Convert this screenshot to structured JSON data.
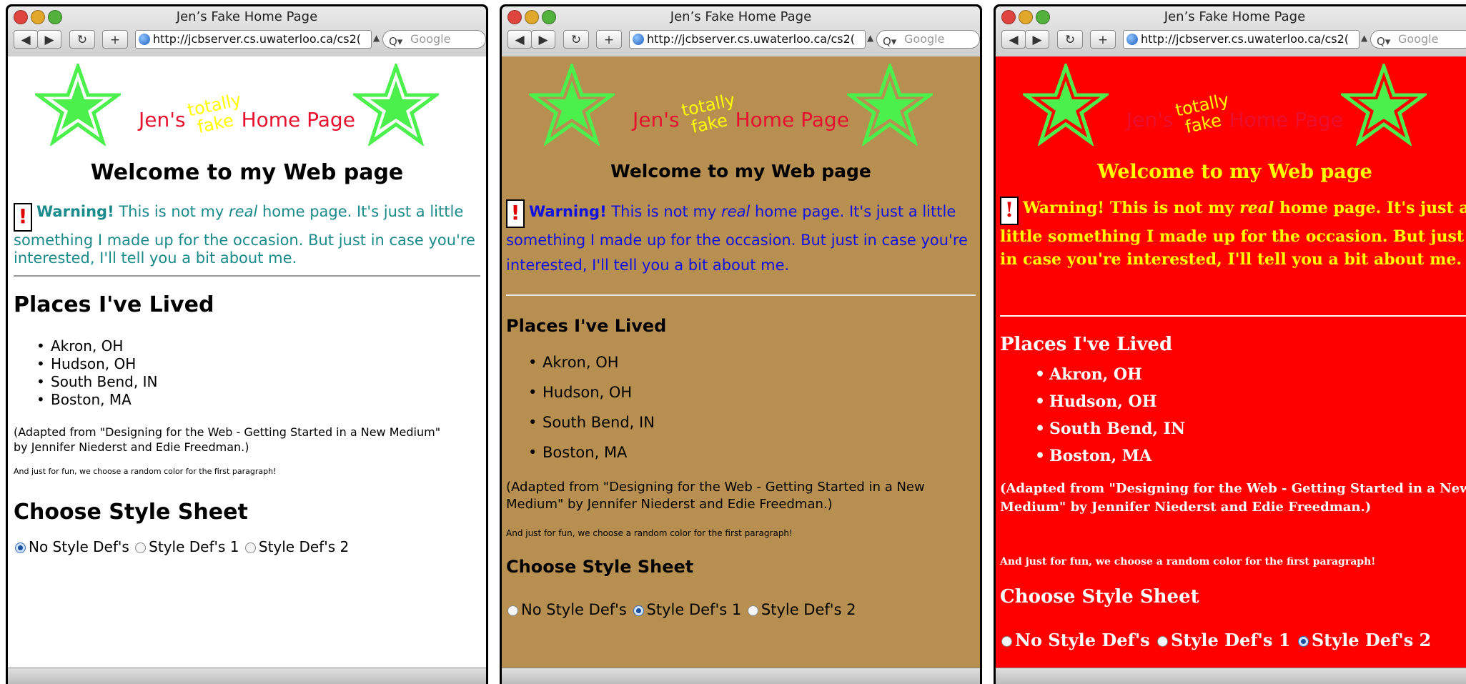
{
  "window_title": "Jen’s Fake Home Page",
  "url": "http://jcbserver.cs.uwaterloo.ca/cs2(",
  "search_placeholder": "Google",
  "nav": {
    "back": "◀",
    "forward": "▶",
    "reload": "↻",
    "add": "+"
  },
  "banner": {
    "jens": "Jen's",
    "totally": "totally",
    "fake": "fake",
    "home_page": "Home Page"
  },
  "welcome": "Welcome to my Web page",
  "warning": {
    "bold": "Warning!",
    "before_real": "This is not my",
    "real": "real",
    "after_real": "home page. It's just a little something I made up for the occasion. But just in case you're interested, I'll tell you a bit about me.",
    "icon": "exclamation-icon"
  },
  "places_heading": "Places I've Lived",
  "places": [
    "Akron, OH",
    "Hudson, OH",
    "South Bend, IN",
    "Boston, MA"
  ],
  "adapted": "(Adapted from \"Designing for the Web - Getting Started in a New Medium\" by Jennifer Niederst and Edie Freedman.)",
  "fun": "And just for fun, we choose a random color for the first paragraph!",
  "choose_heading": "Choose Style Sheet",
  "radio_options": [
    "No Style Def's",
    "Style Def's 1",
    "Style Def's 2"
  ],
  "windows": [
    {
      "selected_option": 0,
      "background": "#ffffff",
      "warning_color": "#1a8a8a"
    },
    {
      "selected_option": 1,
      "background": "#b78f51",
      "warning_color": "#1010e0"
    },
    {
      "selected_option": 2,
      "background": "#ff0000",
      "warning_color": "#ffff00"
    }
  ],
  "colors": {
    "star": "#4cf04c",
    "banner_text": "#e8102e",
    "totally": "#ffff00"
  }
}
